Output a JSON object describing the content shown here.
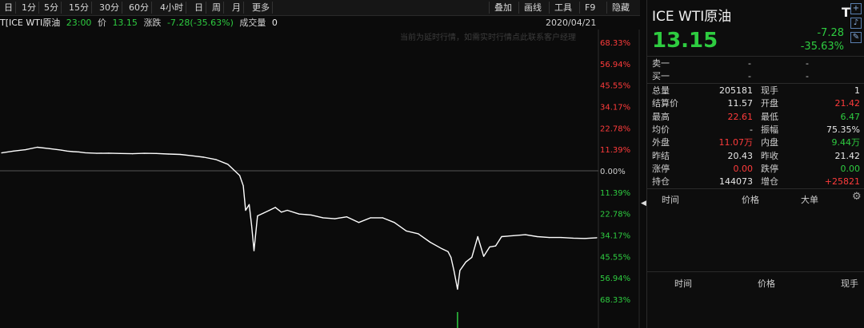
{
  "toolbar": {
    "periods": [
      "日",
      "1分",
      "5分",
      "15分",
      "30分",
      "60分",
      "4小时",
      "日",
      "周",
      "月",
      "更多"
    ],
    "right_buttons": [
      "叠加",
      "画线",
      "工具",
      "F9",
      "隐藏"
    ]
  },
  "info": {
    "symbol": "T[ICE WTI原油",
    "time": "23:00",
    "price_label": "价",
    "price": "13.15",
    "change_label": "涨跌",
    "change": "-7.28(-35.63%)",
    "volume_label": "成交量",
    "volume": "0",
    "date": "2020/04/21",
    "notice": "当前为延时行情，如需实时行情点此联系客户经理"
  },
  "colors": {
    "up": "#ff3b3b",
    "down": "#2ecc40",
    "line": "#ffffff",
    "zero_line": "#cfcfcf",
    "background": "#0b0b0b"
  },
  "chart_data": {
    "type": "line",
    "title": "",
    "xlabel": "",
    "ylabel": "",
    "y_unit": "percent change vs. previous settlement",
    "ylim": [
      -68.33,
      68.33
    ],
    "y_tick_labels_right": [
      "68.33%",
      "56.94%",
      "45.55%",
      "34.17%",
      "22.78%",
      "11.39%",
      "0.00%",
      "11.39%",
      "22.78%",
      "34.17%",
      "45.55%",
      "56.94%",
      "68.33%"
    ],
    "y_tick_colors": [
      "up",
      "up",
      "up",
      "up",
      "up",
      "up",
      "neutral",
      "down",
      "down",
      "down",
      "down",
      "down",
      "down"
    ],
    "x": [
      0,
      2,
      4,
      6,
      8,
      10,
      11,
      12,
      13,
      14,
      16,
      18,
      20,
      22,
      24,
      26,
      28,
      30,
      32,
      34,
      36,
      38,
      40,
      40.6,
      41,
      41.6,
      42,
      42.4,
      43,
      44,
      45,
      46,
      47,
      48,
      50,
      52,
      54,
      56,
      58,
      60,
      62,
      64,
      66,
      68,
      70,
      72,
      74,
      75,
      75.5,
      76,
      76.6,
      77,
      78,
      79,
      80,
      81,
      82,
      83,
      84,
      86,
      88,
      90,
      92,
      94,
      96,
      98,
      100
    ],
    "values": [
      9.5,
      10.5,
      11.2,
      12.5,
      11.8,
      11.0,
      10.5,
      10.2,
      10.0,
      9.6,
      9.3,
      9.4,
      9.2,
      9.1,
      9.3,
      9.2,
      8.9,
      8.7,
      8.0,
      7.2,
      6.0,
      3.5,
      -2.5,
      -8.0,
      -21.0,
      -18.0,
      -29.0,
      -42.5,
      -24.0,
      -22.5,
      -21.0,
      -19.5,
      -22.0,
      -21.0,
      -23.0,
      -23.5,
      -25.0,
      -25.5,
      -24.5,
      -27.5,
      -25.0,
      -25.0,
      -27.5,
      -32.0,
      -33.5,
      -38.0,
      -41.5,
      -43.0,
      -46.0,
      -53.0,
      -63.0,
      -53.0,
      -48.5,
      -46.0,
      -35.0,
      -45.5,
      -40.5,
      -40.0,
      -35.0,
      -34.5,
      -34.0,
      -35.0,
      -35.5,
      -35.5,
      -35.8,
      -36.0,
      -35.6
    ]
  },
  "panel": {
    "name": "ICE WTI原油",
    "tag": "T",
    "last": "13.15",
    "change": "-7.28",
    "change_pct": "-35.63%",
    "order_book": [
      {
        "label": "卖一",
        "price": "-",
        "vol": "-"
      },
      {
        "label": "买一",
        "price": "-",
        "vol": "-"
      }
    ],
    "stats": [
      {
        "l1": "总量",
        "v1": "205181",
        "c1": "white",
        "l2": "现手",
        "v2": "1",
        "c2": "white"
      },
      {
        "l1": "结算价",
        "v1": "11.57",
        "c1": "white",
        "l2": "开盘",
        "v2": "21.42",
        "c2": "red"
      },
      {
        "l1": "最高",
        "v1": "22.61",
        "c1": "red",
        "l2": "最低",
        "v2": "6.47",
        "c2": "green"
      },
      {
        "l1": "均价",
        "v1": "-",
        "c1": "white",
        "l2": "振幅",
        "v2": "75.35%",
        "c2": "white"
      },
      {
        "l1": "外盘",
        "v1": "11.07万",
        "c1": "red",
        "l2": "内盘",
        "v2": "9.44万",
        "c2": "green"
      },
      {
        "l1": "昨结",
        "v1": "20.43",
        "c1": "white",
        "l2": "昨收",
        "v2": "21.42",
        "c2": "white"
      },
      {
        "l1": "涨停",
        "v1": "0.00",
        "c1": "red",
        "l2": "跌停",
        "v2": "0.00",
        "c2": "green"
      },
      {
        "l1": "持仓",
        "v1": "144073",
        "c1": "white",
        "l2": "增仓",
        "v2": "+25821",
        "c2": "red"
      }
    ],
    "big_orders_headers": [
      "时间",
      "价格",
      "大单"
    ],
    "ticks_headers": [
      "时间",
      "价格",
      "现手"
    ],
    "icons": [
      "plus-icon",
      "bell-icon",
      "edit-icon",
      "gear-icon",
      "expand-arrow-icon"
    ]
  }
}
